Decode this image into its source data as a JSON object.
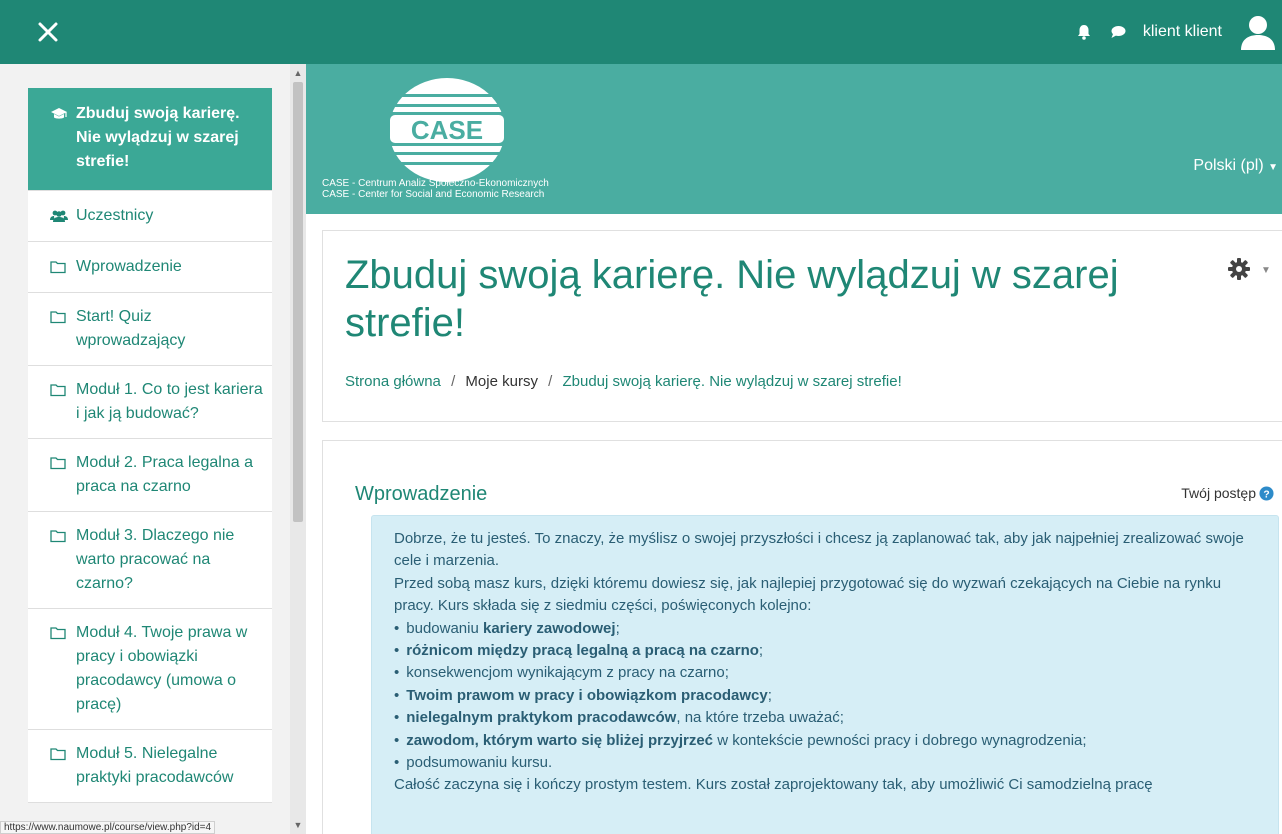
{
  "topbar": {
    "username": "klient klient",
    "colors": {
      "bar": "#1f8775"
    }
  },
  "sidebar": {
    "course_title": "Zbuduj swoją karierę. Nie wylądzuj w szarej strefie!",
    "items": [
      {
        "label": "Zbuduj swoją karierę. Nie wylądzuj w szarej strefie!",
        "icon": "graduation-cap-icon"
      },
      {
        "label": "Uczestnicy",
        "icon": "users-icon"
      },
      {
        "label": "Wprowadzenie",
        "icon": "folder-icon"
      },
      {
        "label": "Start! Quiz wprowadzający",
        "icon": "folder-icon"
      },
      {
        "label": "Moduł 1. Co to jest kariera i jak ją budować?",
        "icon": "folder-icon"
      },
      {
        "label": "Moduł 2. Praca legalna a praca na czarno",
        "icon": "folder-icon"
      },
      {
        "label": "Moduł 3. Dlaczego nie warto pracować na czarno?",
        "icon": "folder-icon"
      },
      {
        "label": "Moduł 4. Twoje prawa w pracy i obowiązki pracodawcy (umowa o pracę)",
        "icon": "folder-icon"
      },
      {
        "label": "Moduł 5. Nielegalne praktyki pracodawców",
        "icon": "folder-icon"
      }
    ]
  },
  "status_url": "https://www.naumowe.pl/course/view.php?id=4",
  "header": {
    "logo_text": "CASE",
    "caption_line1": "CASE - Centrum Analiz Społeczno-Ekonomicznych",
    "caption_line2": "CASE - Center for Social and Economic Research",
    "language": "Polski (pl)"
  },
  "page": {
    "title": "Zbuduj swoją karierę. Nie wylądzuj w szarej strefie!",
    "breadcrumb": {
      "home": "Strona główna",
      "sep": "/",
      "my_courses": "Moje kursy",
      "current": "Zbuduj swoją karierę. Nie wylądzuj w szarej strefie!"
    }
  },
  "section": {
    "title": "Wprowadzenie",
    "progress_label": "Twój postęp",
    "intro_1": "Dobrze, że tu jesteś. To znaczy, że myślisz o swojej przyszłości i chcesz ją zaplanować tak, aby jak najpełniej zrealizować swoje cele i marzenia.",
    "intro_2": "Przed sobą masz kurs, dzięki któremu dowiesz się, jak najlepiej przygotować się do wyzwań czekających na Ciebie na rynku pracy. Kurs składa się z siedmiu części, poświęconych kolejno:",
    "bullets": {
      "b1_pre": "budowaniu ",
      "b1_bold": "kariery zawodowej",
      "b1_post": ";",
      "b2_bold": "różnicom między pracą legalną a pracą na czarno",
      "b2_post": ";",
      "b3": "konsekwencjom wynikającym z pracy na czarno;",
      "b4_bold": "Twoim prawom w pracy i obowiązkom pracodawcy",
      "b4_post": ";",
      "b5_bold": "nielegalnym praktykom pracodawców",
      "b5_post": ", na które trzeba uważać;",
      "b6_bold": "zawodom, którym warto się bliżej przyjrzeć",
      "b6_post": " w kontekście pewności pracy i dobrego wynagrodzenia;",
      "b7": "podsumowaniu kursu."
    },
    "outro": "Całość zaczyna się i kończy prostym testem. Kurs został zaprojektowany tak, aby umożliwić Ci samodzielną pracę"
  }
}
